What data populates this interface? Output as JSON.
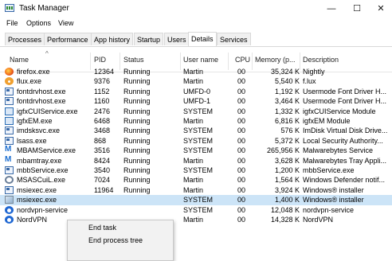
{
  "window": {
    "title": "Task Manager",
    "minimize": "—",
    "maximize": "☐",
    "close": "✕"
  },
  "menu": [
    "File",
    "Options",
    "View"
  ],
  "tabs": [
    "Processes",
    "Performance",
    "App history",
    "Startup",
    "Users",
    "Details",
    "Services"
  ],
  "active_tab": "Details",
  "columns": [
    "Name",
    "PID",
    "Status",
    "User name",
    "CPU",
    "Memory (p...",
    "Description"
  ],
  "sort_indicator": "^",
  "rows": [
    {
      "icon": "firefox-icon",
      "name": "firefox.exe",
      "pid": "12364",
      "status": "Running",
      "user": "Martin",
      "cpu": "00",
      "mem": "35,324 K",
      "desc": "Nightly"
    },
    {
      "icon": "flux-icon",
      "name": "flux.exe",
      "pid": "9376",
      "status": "Running",
      "user": "Martin",
      "cpu": "00",
      "mem": "5,540 K",
      "desc": "f.lux"
    },
    {
      "icon": "window-icon",
      "name": "fontdrvhost.exe",
      "pid": "1152",
      "status": "Running",
      "user": "UMFD-0",
      "cpu": "00",
      "mem": "1,192 K",
      "desc": "Usermode Font Driver H..."
    },
    {
      "icon": "window-icon",
      "name": "fontdrvhost.exe",
      "pid": "1160",
      "status": "Running",
      "user": "UMFD-1",
      "cpu": "00",
      "mem": "3,464 K",
      "desc": "Usermode Font Driver H..."
    },
    {
      "icon": "intel-icon",
      "name": "igfxCUIService.exe",
      "pid": "2476",
      "status": "Running",
      "user": "SYSTEM",
      "cpu": "00",
      "mem": "1,332 K",
      "desc": "igfxCUIService Module"
    },
    {
      "icon": "intel-icon",
      "name": "igfxEM.exe",
      "pid": "6468",
      "status": "Running",
      "user": "Martin",
      "cpu": "00",
      "mem": "6,816 K",
      "desc": "igfxEM Module"
    },
    {
      "icon": "window-icon",
      "name": "imdsksvc.exe",
      "pid": "3468",
      "status": "Running",
      "user": "SYSTEM",
      "cpu": "00",
      "mem": "576 K",
      "desc": "ImDisk Virtual Disk Drive..."
    },
    {
      "icon": "window-icon",
      "name": "lsass.exe",
      "pid": "868",
      "status": "Running",
      "user": "SYSTEM",
      "cpu": "00",
      "mem": "5,372 K",
      "desc": "Local Security Authority..."
    },
    {
      "icon": "mbam-icon",
      "name": "MBAMService.exe",
      "pid": "3516",
      "status": "Running",
      "user": "SYSTEM",
      "cpu": "00",
      "mem": "265,956 K",
      "desc": "Malwarebytes Service"
    },
    {
      "icon": "mbam-icon",
      "name": "mbamtray.exe",
      "pid": "8424",
      "status": "Running",
      "user": "Martin",
      "cpu": "00",
      "mem": "3,628 K",
      "desc": "Malwarebytes Tray Appli..."
    },
    {
      "icon": "window-icon",
      "name": "mbbService.exe",
      "pid": "3540",
      "status": "Running",
      "user": "SYSTEM",
      "cpu": "00",
      "mem": "1,200 K",
      "desc": "mbbService.exe"
    },
    {
      "icon": "gear-icon",
      "name": "MSASCuiL.exe",
      "pid": "7024",
      "status": "Running",
      "user": "Martin",
      "cpu": "00",
      "mem": "1,564 K",
      "desc": "Windows Defender notif..."
    },
    {
      "icon": "window-icon",
      "name": "msiexec.exe",
      "pid": "11964",
      "status": "Running",
      "user": "Martin",
      "cpu": "00",
      "mem": "3,924 K",
      "desc": "Windows® installer"
    },
    {
      "icon": "msi-icon",
      "name": "msiexec.exe",
      "pid": "",
      "status": "",
      "user": "SYSTEM",
      "cpu": "00",
      "mem": "1,400 K",
      "desc": "Windows® installer",
      "selected": true
    },
    {
      "icon": "vpn-icon",
      "name": "nordvpn-service",
      "pid": "",
      "status": "",
      "user": "SYSTEM",
      "cpu": "00",
      "mem": "12,048 K",
      "desc": "nordvpn-service"
    },
    {
      "icon": "vpn-icon",
      "name": "NordVPN",
      "pid": "",
      "status": "",
      "user": "Martin",
      "cpu": "00",
      "mem": "14,328 K",
      "desc": "NordVPN"
    }
  ],
  "context_menu": [
    "End task",
    "End process tree"
  ],
  "colors": {
    "selection": "#cce4f7",
    "accent": "#1f67d2"
  }
}
